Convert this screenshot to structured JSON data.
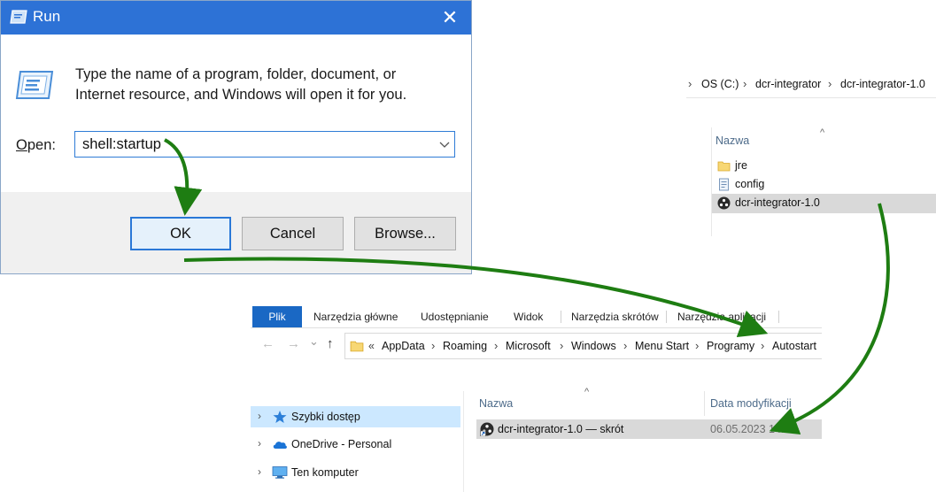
{
  "run_dialog": {
    "title": "Run",
    "description": "Type the name of a program, folder, document, or Internet resource, and Windows will open it for you.",
    "open_label": "Open:",
    "open_value": "shell:startup",
    "ok_label": "OK",
    "cancel_label": "Cancel",
    "browse_label": "Browse..."
  },
  "top_explorer": {
    "breadcrumb": [
      "OS (C:)",
      "dcr-integrator",
      "dcr-integrator-1.0"
    ],
    "column_name": "Nazwa",
    "files": [
      {
        "name": "jre",
        "icon": "folder-icon"
      },
      {
        "name": "config",
        "icon": "config-file-icon"
      },
      {
        "name": "dcr-integrator-1.0",
        "icon": "app-exe-icon"
      }
    ]
  },
  "bottom_explorer": {
    "ribbon_tabs": [
      "Plik",
      "Narzędzia główne",
      "Udostępnianie",
      "Widok",
      "Narzędzia skrótów",
      "Narzędzia aplikacji"
    ],
    "breadcrumb": [
      "AppData",
      "Roaming",
      "Microsoft",
      "Windows",
      "Menu Start",
      "Programy",
      "Autostart"
    ],
    "nav_items": [
      {
        "label": "Szybki dostęp",
        "icon": "star-icon"
      },
      {
        "label": "OneDrive - Personal",
        "icon": "cloud-icon"
      },
      {
        "label": "Ten komputer",
        "icon": "computer-icon"
      }
    ],
    "column_name": "Nazwa",
    "column_date": "Data modyfikacji",
    "shortcut": {
      "name": "dcr-integrator-1.0 — skrót",
      "date": "06.05.2023 14:55"
    }
  },
  "colors": {
    "titlebar": "#2d72d6",
    "arrow": "#1e7d12",
    "selection": "#d9d9d9",
    "nav_selection": "#cce8ff",
    "ribbon_file_tab": "#1a68c4"
  }
}
